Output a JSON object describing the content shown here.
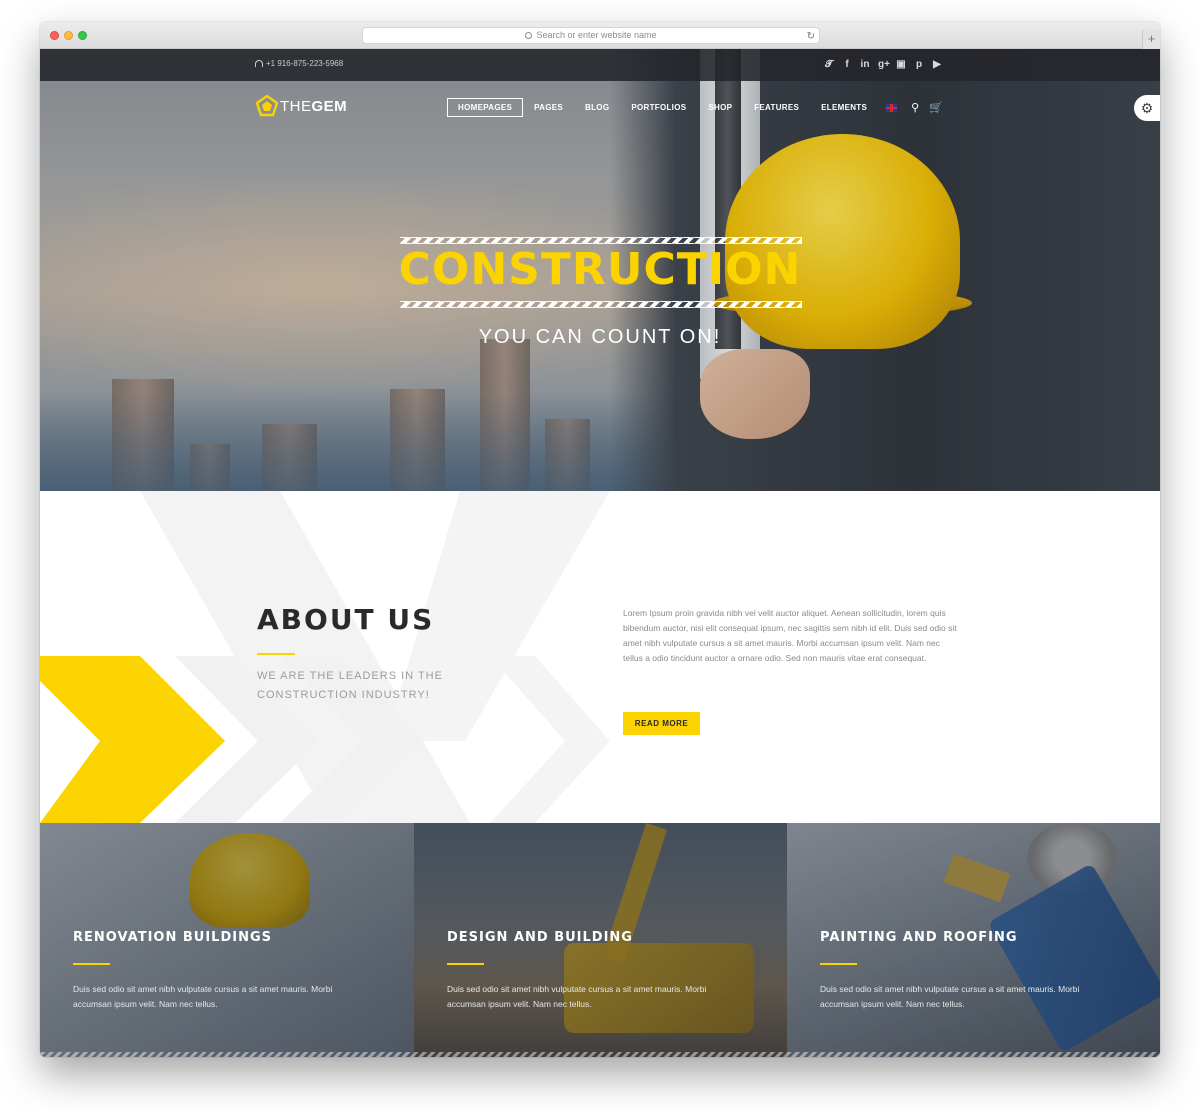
{
  "browser": {
    "url_placeholder": "Search or enter website name",
    "new_tab": "+"
  },
  "topbar": {
    "phone": "+1 916-875-223-5968",
    "socials": [
      "twitter-icon",
      "facebook-icon",
      "linkedin-icon",
      "googleplus-icon",
      "instagram-icon",
      "pinterest-icon",
      "youtube-icon"
    ]
  },
  "header": {
    "logo_light": "THE",
    "logo_bold": "GEM",
    "nav": [
      "HOMEPAGES",
      "PAGES",
      "BLOG",
      "PORTFOLIOS",
      "SHOP",
      "FEATURES",
      "ELEMENTS"
    ],
    "active_nav": "HOMEPAGES"
  },
  "hero": {
    "title": "CONSTRUCTION",
    "subtitle": "YOU CAN COUNT ON!"
  },
  "about": {
    "title": "ABOUT US",
    "subtitle": "WE ARE THE LEADERS IN THE CONSTRUCTION INDUSTRY!",
    "text": "Lorem Ipsum proin gravida nibh vel velit auctor aliquet. Aenean sollicitudin, lorem quis bibendum auctor, nisi elit consequat ipsum, nec sagittis sem nibh id elit. Duis sed odio sit amet nibh vulputate cursus a sit amet mauris. Morbi accumsan ipsum velit. Nam nec tellus a odio tincidunt auctor a ornare odio. Sed non  mauris vitae erat consequat.",
    "button": "READ MORE"
  },
  "services": [
    {
      "title": "RENOVATION BUILDINGS",
      "text": "Duis sed odio sit amet nibh vulputate cursus a sit amet mauris. Morbi accumsan ipsum velit. Nam nec tellus."
    },
    {
      "title": "DESIGN AND BUILDING",
      "text": "Duis sed odio sit amet nibh vulputate cursus a sit amet mauris. Morbi accumsan ipsum velit. Nam nec tellus."
    },
    {
      "title": "PAINTING AND ROOFING",
      "text": "Duis sed odio sit amet nibh vulputate cursus a sit amet mauris. Morbi accumsan ipsum velit. Nam nec tellus."
    }
  ],
  "colors": {
    "accent": "#fbd300",
    "dark": "#2a2a2a",
    "topbar": "#23262b"
  }
}
